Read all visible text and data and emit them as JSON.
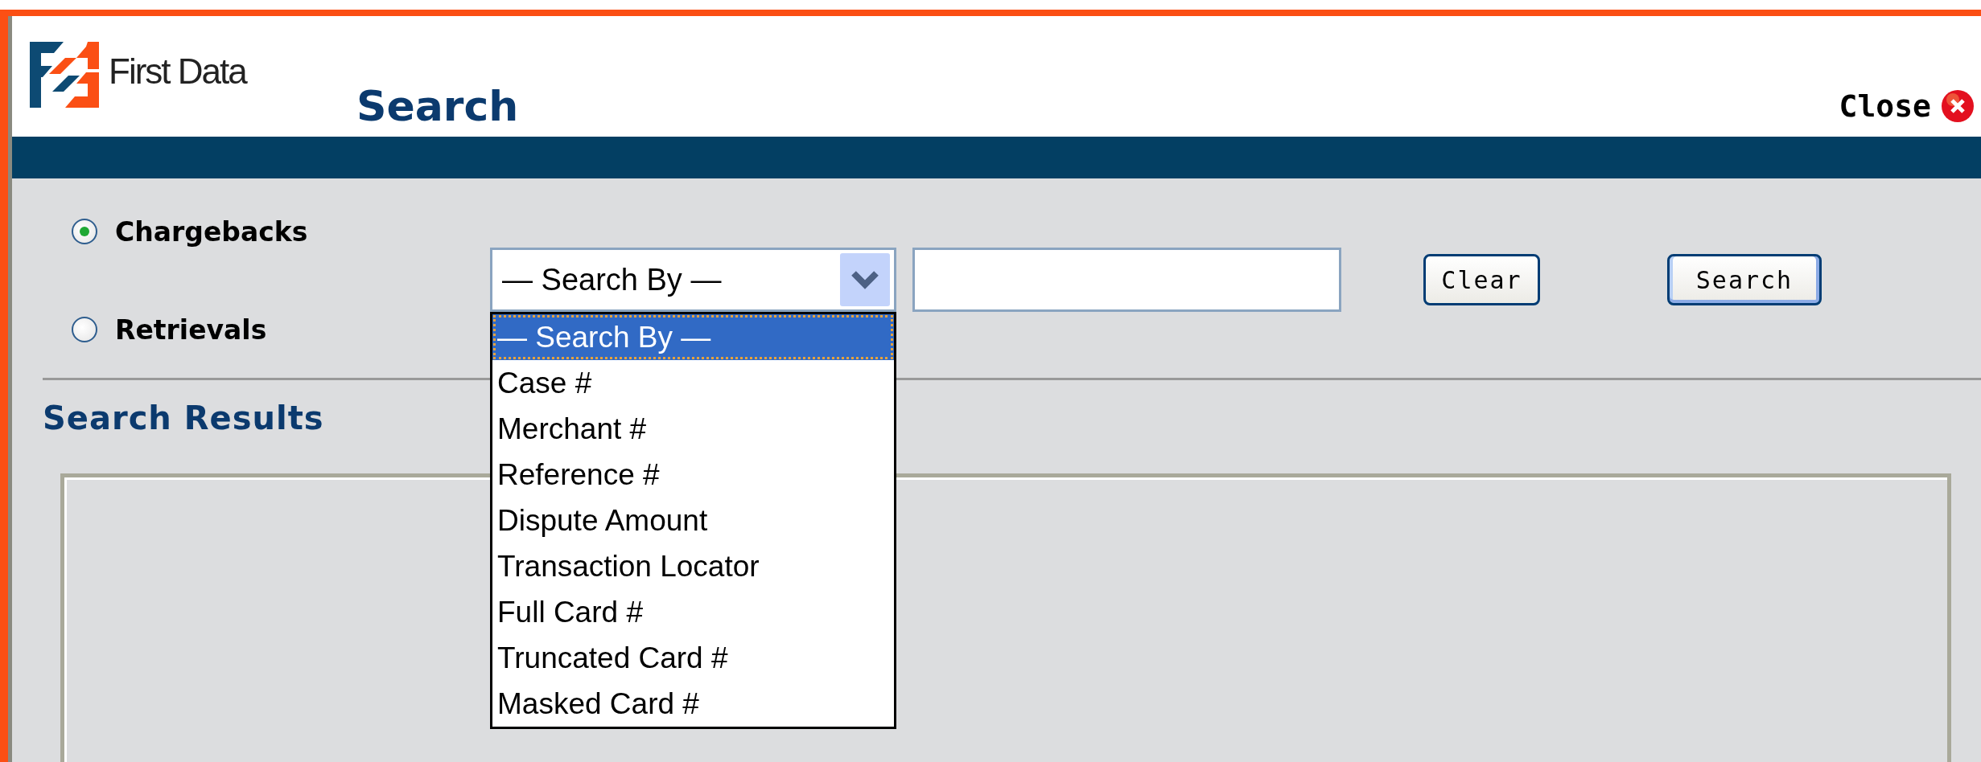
{
  "header": {
    "brand": "First Data",
    "title": "Search",
    "close_label": "Close"
  },
  "search_type": [
    {
      "label": "Chargebacks",
      "selected": true
    },
    {
      "label": "Retrievals",
      "selected": false
    }
  ],
  "search_by": {
    "value": "— Search By —",
    "expanded": true,
    "options": [
      {
        "label": "— Search By —",
        "selected": true
      },
      {
        "label": "Case #",
        "selected": false
      },
      {
        "label": "Merchant #",
        "selected": false
      },
      {
        "label": "Reference #",
        "selected": false
      },
      {
        "label": "Dispute Amount",
        "selected": false
      },
      {
        "label": "Transaction Locator",
        "selected": false
      },
      {
        "label": "Full Card #",
        "selected": false
      },
      {
        "label": "Truncated Card #",
        "selected": false
      },
      {
        "label": "Masked Card #",
        "selected": false
      }
    ]
  },
  "buttons": [
    {
      "label": "Clear",
      "kind": "plain"
    },
    {
      "label": "Search",
      "kind": "default"
    }
  ],
  "results": {
    "title": "Search Results"
  }
}
